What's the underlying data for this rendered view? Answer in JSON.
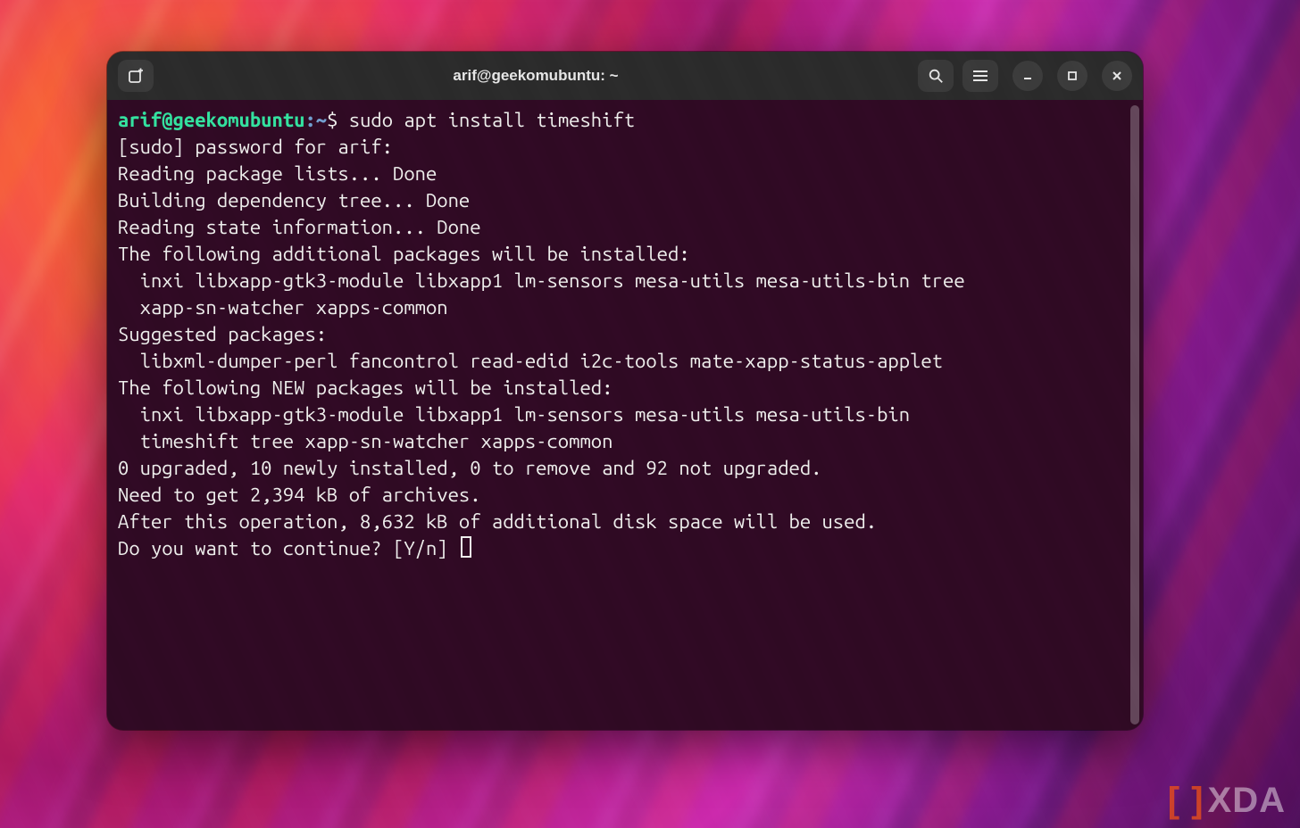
{
  "window": {
    "title": "arif@geekomubuntu: ~"
  },
  "prompt": {
    "userhost": "arif@geekomubuntu",
    "sep": ":",
    "path": "~",
    "symbol": "$",
    "command": "sudo apt install timeshift"
  },
  "output": {
    "lines": [
      "[sudo] password for arif:",
      "Reading package lists... Done",
      "Building dependency tree... Done",
      "Reading state information... Done",
      "The following additional packages will be installed:",
      "  inxi libxapp-gtk3-module libxapp1 lm-sensors mesa-utils mesa-utils-bin tree",
      "  xapp-sn-watcher xapps-common",
      "Suggested packages:",
      "  libxml-dumper-perl fancontrol read-edid i2c-tools mate-xapp-status-applet",
      "The following NEW packages will be installed:",
      "  inxi libxapp-gtk3-module libxapp1 lm-sensors mesa-utils mesa-utils-bin",
      "  timeshift tree xapp-sn-watcher xapps-common",
      "0 upgraded, 10 newly installed, 0 to remove and 92 not upgraded.",
      "Need to get 2,394 kB of archives.",
      "After this operation, 8,632 kB of additional disk space will be used.",
      "Do you want to continue? [Y/n] "
    ]
  },
  "watermark": {
    "brackets": "[ ]",
    "text": "XDA"
  }
}
